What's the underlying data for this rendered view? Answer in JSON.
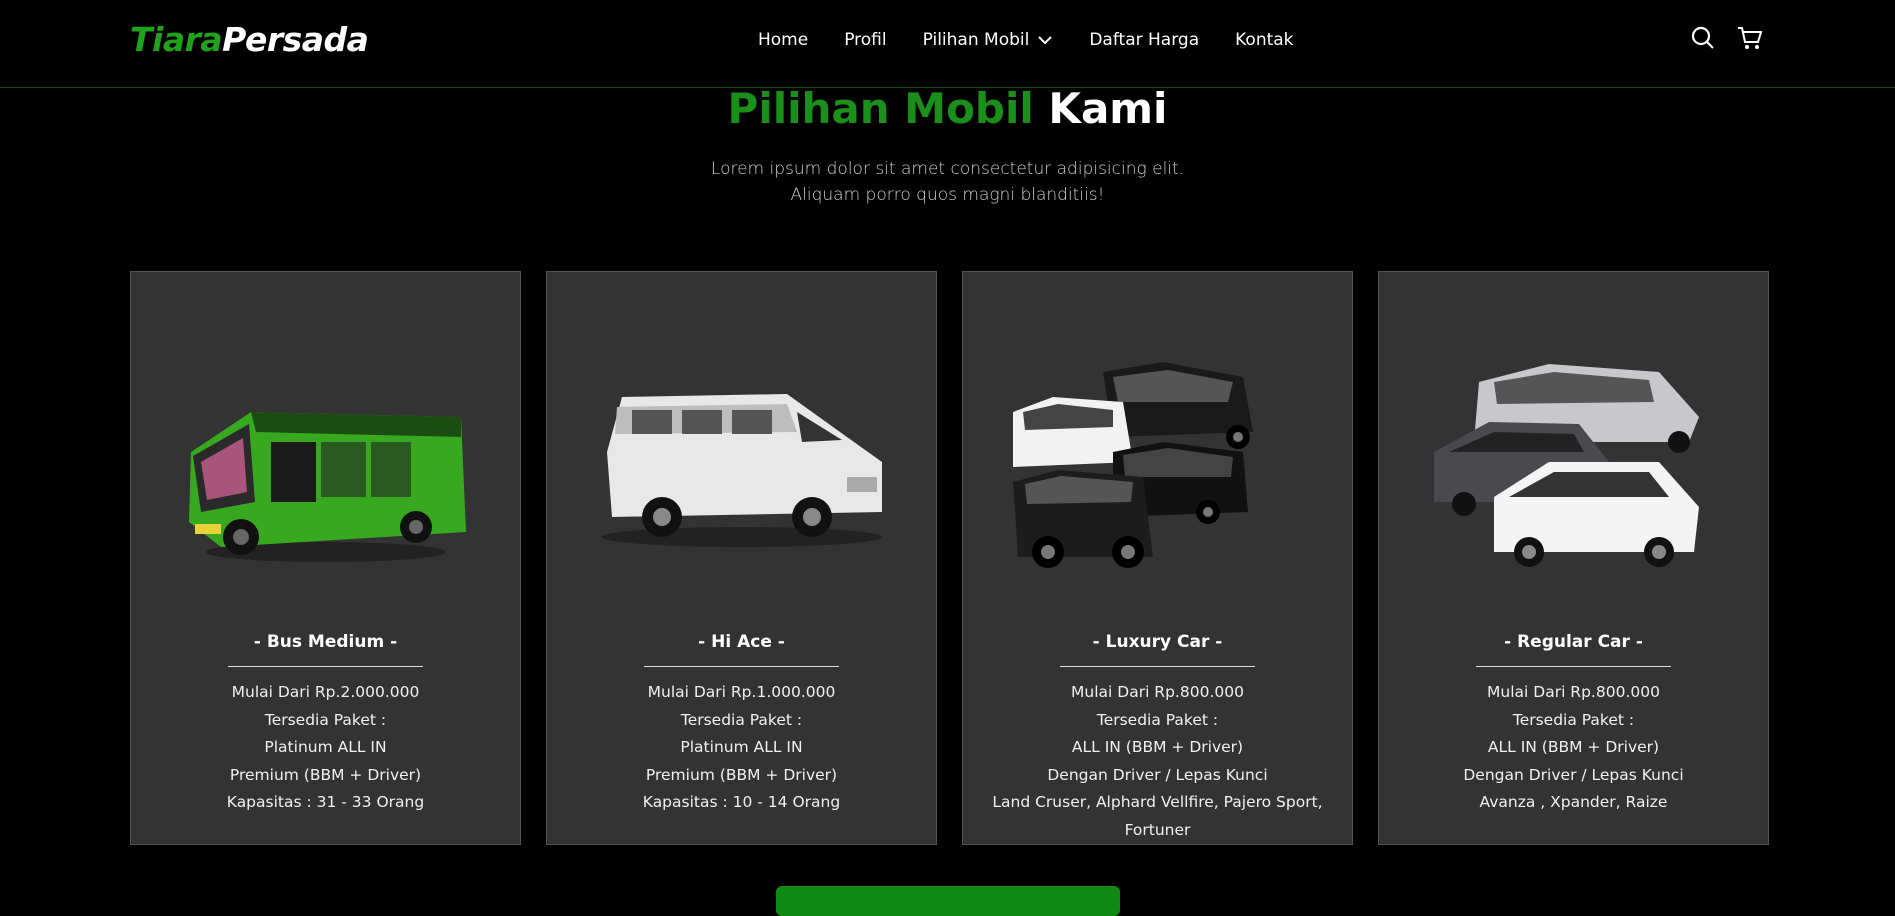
{
  "brand": {
    "part1": "Tiara",
    "part2": "Persada"
  },
  "nav": {
    "items": [
      "Home",
      "Profil",
      "Pilihan Mobil",
      "Daftar Harga",
      "Kontak"
    ]
  },
  "colors": {
    "accent": "#1ea31b",
    "card_bg": "#333333",
    "background": "#000000"
  },
  "section": {
    "title_green": "Pilihan Mobil",
    "title_white": "Kami",
    "subtitle_line1": "Lorem ipsum dolor sit amet consectetur adipisicing elit.",
    "subtitle_line2": "Aliquam porro quos magni blanditiis!"
  },
  "cards": [
    {
      "name": "- Bus Medium -",
      "lines": [
        "Mulai Dari Rp.2.000.000",
        "Tersedia Paket :",
        "Platinum ALL IN",
        "Premium (BBM + Driver)",
        "Kapasitas : 31 - 33 Orang"
      ],
      "image": "green-bus-image"
    },
    {
      "name": "- Hi Ace -",
      "lines": [
        "Mulai Dari Rp.1.000.000",
        "Tersedia Paket :",
        "Platinum ALL IN",
        "Premium (BBM + Driver)",
        "Kapasitas : 10 - 14 Orang"
      ],
      "image": "white-van-image"
    },
    {
      "name": "- Luxury Car -",
      "lines": [
        "Mulai Dari Rp.800.000",
        "Tersedia Paket :",
        "ALL IN (BBM + Driver)",
        "Dengan Driver / Lepas Kunci",
        "Land Cruser, Alphard Vellfire, Pajero Sport, Fortuner"
      ],
      "image": "luxury-cars-image"
    },
    {
      "name": "- Regular Car -",
      "lines": [
        "Mulai Dari Rp.800.000",
        "Tersedia Paket :",
        "ALL IN (BBM + Driver)",
        "Dengan Driver / Lepas Kunci",
        "Avanza , Xpander, Raize"
      ],
      "image": "regular-cars-image"
    }
  ]
}
